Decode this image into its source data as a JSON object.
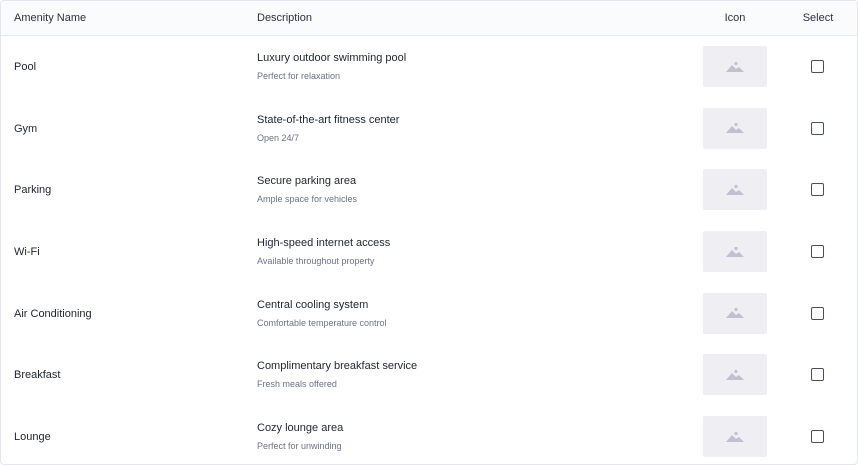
{
  "header": {
    "name": "Amenity Name",
    "description": "Description",
    "icon": "Icon",
    "select": "Select"
  },
  "rows": [
    {
      "name": "Pool",
      "title": "Luxury outdoor swimming pool",
      "subtitle": "Perfect for relaxation",
      "icon": "image-placeholder-icon",
      "selected": false
    },
    {
      "name": "Gym",
      "title": "State-of-the-art fitness center",
      "subtitle": "Open 24/7",
      "icon": "image-placeholder-icon",
      "selected": false
    },
    {
      "name": "Parking",
      "title": "Secure parking area",
      "subtitle": "Ample space for vehicles",
      "icon": "image-placeholder-icon",
      "selected": false
    },
    {
      "name": "Wi-Fi",
      "title": "High-speed internet access",
      "subtitle": "Available throughout property",
      "icon": "image-placeholder-icon",
      "selected": false
    },
    {
      "name": "Air Conditioning",
      "title": "Central cooling system",
      "subtitle": "Comfortable temperature control",
      "icon": "image-placeholder-icon",
      "selected": false
    },
    {
      "name": "Breakfast",
      "title": "Complimentary breakfast service",
      "subtitle": "Fresh meals offered",
      "icon": "image-placeholder-icon",
      "selected": false
    },
    {
      "name": "Lounge",
      "title": "Cozy lounge area",
      "subtitle": "Perfect for unwinding",
      "icon": "image-placeholder-icon",
      "selected": false
    }
  ],
  "colors": {
    "icon_bg": "#efeef3",
    "icon_fg": "#c3bfd0",
    "border": "#e3e6ec",
    "subtitle": "#6b7385"
  }
}
